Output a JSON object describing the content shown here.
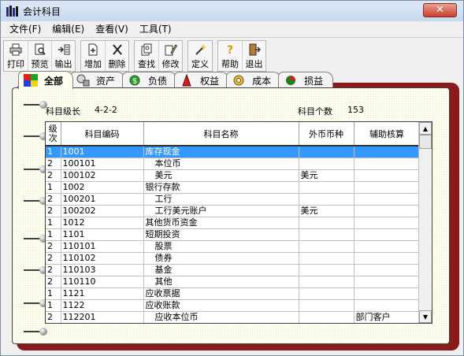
{
  "window": {
    "title": "会计科目",
    "close_label": "✕"
  },
  "menu": [
    {
      "label": "文件(F)",
      "name": "menu-file"
    },
    {
      "label": "编辑(E)",
      "name": "menu-edit"
    },
    {
      "label": "查看(V)",
      "name": "menu-view"
    },
    {
      "label": "工具(T)",
      "name": "menu-tools"
    }
  ],
  "toolbar": {
    "print": "打印",
    "preview": "预览",
    "export": "输出",
    "add": "增加",
    "delete": "删除",
    "find": "查找",
    "edit": "修改",
    "define": "定义",
    "help": "帮助",
    "exit": "退出"
  },
  "tabs": [
    {
      "label": "全部",
      "icon": "all-category-icon",
      "active": true
    },
    {
      "label": "资产",
      "icon": "asset-icon"
    },
    {
      "label": "负债",
      "icon": "liability-icon"
    },
    {
      "label": "权益",
      "icon": "equity-icon"
    },
    {
      "label": "成本",
      "icon": "cost-icon"
    },
    {
      "label": "损益",
      "icon": "profit-loss-icon"
    }
  ],
  "info": {
    "level_label": "科目级长",
    "level_value": "4-2-2",
    "count_label": "科目个数",
    "count_value": "153"
  },
  "table": {
    "headers": {
      "level": "级次",
      "code": "科目编码",
      "name": "科目名称",
      "currency": "外币币种",
      "aux": "辅助核算"
    },
    "rows": [
      {
        "level": "1",
        "code": "1001",
        "name": "库存现金",
        "currency": "",
        "aux": "",
        "selected": true
      },
      {
        "level": "2",
        "code": "100101",
        "name": "本位币",
        "currency": "",
        "aux": ""
      },
      {
        "level": "2",
        "code": "100102",
        "name": "美元",
        "currency": "美元",
        "aux": ""
      },
      {
        "level": "1",
        "code": "1002",
        "name": "银行存款",
        "currency": "",
        "aux": ""
      },
      {
        "level": "2",
        "code": "100201",
        "name": "工行",
        "currency": "",
        "aux": ""
      },
      {
        "level": "2",
        "code": "100202",
        "name": "工行美元账户",
        "currency": "美元",
        "aux": ""
      },
      {
        "level": "1",
        "code": "1012",
        "name": "其他货币资金",
        "currency": "",
        "aux": ""
      },
      {
        "level": "1",
        "code": "1101",
        "name": "短期投资",
        "currency": "",
        "aux": ""
      },
      {
        "level": "2",
        "code": "110101",
        "name": "股票",
        "currency": "",
        "aux": ""
      },
      {
        "level": "2",
        "code": "110102",
        "name": "债券",
        "currency": "",
        "aux": ""
      },
      {
        "level": "2",
        "code": "110103",
        "name": "基金",
        "currency": "",
        "aux": ""
      },
      {
        "level": "2",
        "code": "110110",
        "name": "其他",
        "currency": "",
        "aux": ""
      },
      {
        "level": "1",
        "code": "1121",
        "name": "应收票据",
        "currency": "",
        "aux": ""
      },
      {
        "level": "1",
        "code": "1122",
        "name": "应收账款",
        "currency": "",
        "aux": ""
      },
      {
        "level": "2",
        "code": "112201",
        "name": "应收本位币",
        "currency": "",
        "aux": "部门客户"
      }
    ]
  },
  "scrollbar": {
    "up": "▲",
    "down": "▼"
  }
}
